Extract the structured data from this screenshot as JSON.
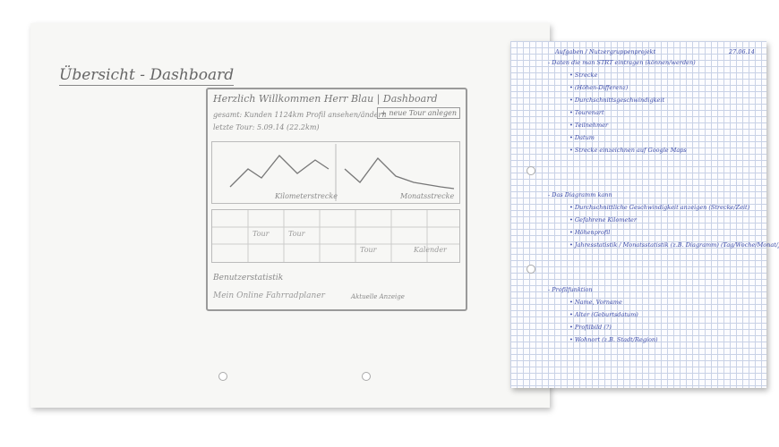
{
  "sketch": {
    "title": "Übersicht - Dashboard",
    "header": "Herzlich Willkommen Herr Blau | Dashboard",
    "row2": "gesamt: Kunden 1124km  Profil ansehen/ändern",
    "add_button": "+ neue Tour anlegen",
    "row3": "letzte Tour: 5.09.14 (22.2km)",
    "chart_left_label": "Kilometerstrecke",
    "chart_right_label": "Monatsstrecke",
    "cal_labels": [
      "Tour",
      "Tour",
      "Tour",
      "Kalender"
    ],
    "stat_label": "Benutzerstatistik",
    "footer": "Mein Online Fahrradplaner",
    "footer_small": "Aktuelle Anzeige"
  },
  "notes": {
    "title": "Aufgaben / Nutzergruppenprojekt",
    "date": "27.06.14",
    "lines": [
      "- Daten die man STRT eintragen (können/werden)",
      "• Strecke",
      "• (Höhen-Differenz)",
      "• Durchschnittsgeschwindigkeit",
      "• Tourenart",
      "• Teilnehmer",
      "• Datum",
      "• Strecke einzeichnen auf Google Maps",
      "- Das Diagramm kann",
      "• Durchschnittliche Geschwindigkeit anzeigen (Strecke/Zeit)",
      "• Gefahrene Kilometer",
      "• Höhenprofil",
      "• Jahresstatistik / Monatsstatistik (z.B. Diagramm) (Tag/Woche/Monat/Jahr)",
      "- Profilfunktion",
      "• Name, Vorname",
      "• Alter (Geburtsdatum)",
      "• Profilbild (?)",
      "• Wohnort (z.B. Stadt/Region)"
    ]
  }
}
